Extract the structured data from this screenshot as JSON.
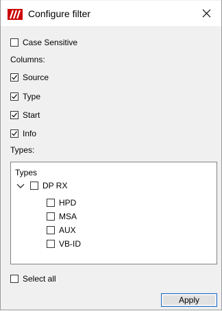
{
  "window": {
    "title": "Configure filter",
    "accent": "#cc0000",
    "icons": {
      "app": "app-logo-icon",
      "close": "close-icon"
    }
  },
  "case_sensitive": {
    "label": "Case Sensitive",
    "checked": false
  },
  "columns": {
    "heading": "Columns:",
    "items": [
      {
        "label": "Source",
        "checked": true
      },
      {
        "label": "Type",
        "checked": true
      },
      {
        "label": "Start",
        "checked": true
      },
      {
        "label": "Info",
        "checked": true
      }
    ]
  },
  "types": {
    "heading": "Types:",
    "tree_header": "Types",
    "root": {
      "label": "DP RX",
      "checked": false,
      "expanded": true
    },
    "children": [
      {
        "label": "HPD",
        "checked": false
      },
      {
        "label": "MSA",
        "checked": false
      },
      {
        "label": "AUX",
        "checked": false
      },
      {
        "label": "VB-ID",
        "checked": false
      }
    ]
  },
  "select_all": {
    "label": "Select all",
    "checked": false
  },
  "apply_label": "Apply"
}
